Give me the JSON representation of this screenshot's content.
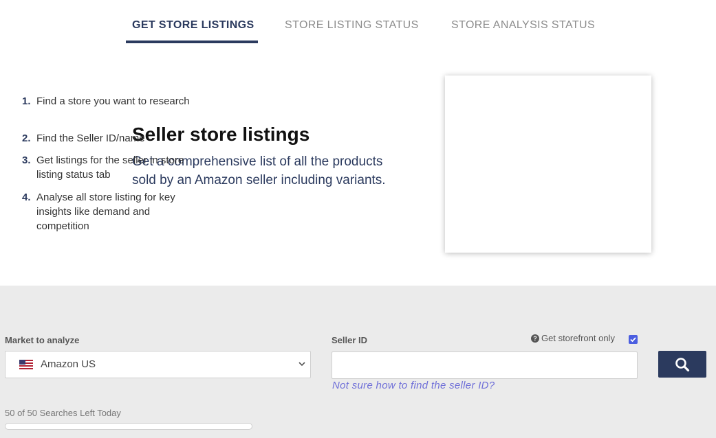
{
  "tabs": [
    {
      "label": "GET STORE LISTINGS",
      "active": true
    },
    {
      "label": "STORE LISTING STATUS",
      "active": false
    },
    {
      "label": "STORE ANALYSIS STATUS",
      "active": false
    }
  ],
  "hero": {
    "title": "Seller store listings",
    "description": "Get a comprehensive list of all the products sold by an Amazon seller including variants."
  },
  "steps": [
    {
      "num": "1.",
      "text": "Find a store you want to research"
    },
    {
      "num": "2.",
      "text": "Find the Seller ID/name"
    },
    {
      "num": "3.",
      "text": "Get listings for the seller in store listing status tab"
    },
    {
      "num": "4.",
      "text": "Analyse all store listing for key insights like demand and competition"
    }
  ],
  "form": {
    "market_label": "Market to analyze",
    "market_value": "Amazon US",
    "market_flag": "us-flag-icon",
    "seller_label": "Seller ID",
    "seller_value": "",
    "storefront_label": "Get storefront only",
    "storefront_checked": true,
    "help_link": "Not sure how to find the seller ID?",
    "searches_left": "50 of 50 Searches Left Today",
    "searches_used_fraction": 0.0
  },
  "colors": {
    "accent": "#2b3a5e",
    "link": "#6f6fd8",
    "checkbox": "#4b5ee0",
    "section_bg": "#ebebeb"
  }
}
